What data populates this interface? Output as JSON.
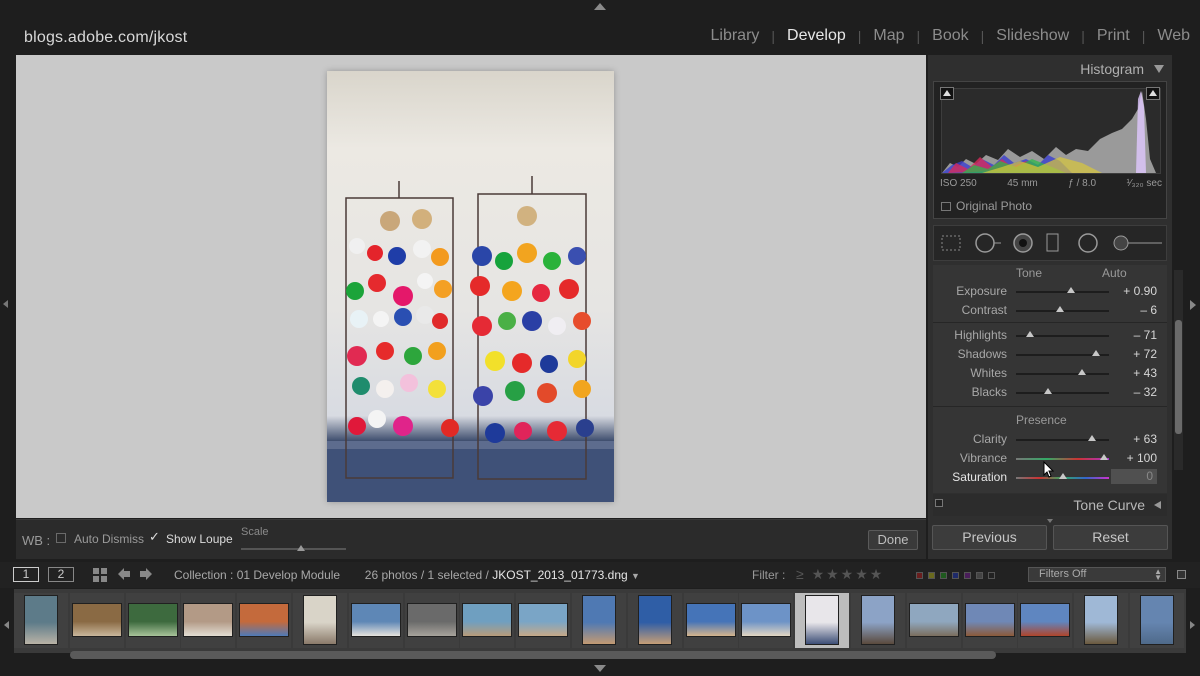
{
  "identity_plate": "blogs.adobe.com/jkost",
  "modules": [
    "Library",
    "Develop",
    "Map",
    "Book",
    "Slideshow",
    "Print",
    "Web"
  ],
  "active_module": "Develop",
  "toolbar": {
    "wb_label": "WB :",
    "auto_dismiss_label": "Auto Dismiss",
    "auto_dismiss_checked": false,
    "show_loupe_label": "Show Loupe",
    "show_loupe_checked": true,
    "scale_label": "Scale",
    "done_label": "Done"
  },
  "histogram": {
    "title": "Histogram",
    "iso": "ISO 250",
    "focal_length": "45 mm",
    "aperture": "ƒ / 8.0",
    "shutter": "¹⁄₃₂₀ sec",
    "original_photo_label": "Original Photo"
  },
  "tools": [
    "crop-overlay",
    "spot-removal",
    "red-eye",
    "graduated-filter",
    "radial-filter",
    "adjustment-brush"
  ],
  "basic": {
    "tone_label": "Tone",
    "auto_label": "Auto",
    "presence_label": "Presence",
    "sliders_tone": [
      {
        "label": "Exposure",
        "value": "+ 0.90",
        "pos": 0.59
      },
      {
        "label": "Contrast",
        "value": "– 6",
        "pos": 0.47
      }
    ],
    "sliders_tone2": [
      {
        "label": "Highlights",
        "value": "– 71",
        "pos": 0.15
      },
      {
        "label": "Shadows",
        "value": "+ 72",
        "pos": 0.86
      },
      {
        "label": "Whites",
        "value": "+ 43",
        "pos": 0.71
      },
      {
        "label": "Blacks",
        "value": "– 32",
        "pos": 0.34
      }
    ],
    "sliders_presence": [
      {
        "label": "Clarity",
        "value": "+ 63",
        "pos": 0.82
      },
      {
        "label": "Vibrance",
        "value": "+ 100",
        "pos": 0.95
      },
      {
        "label": "Saturation",
        "value": "0",
        "pos": 0.5
      }
    ]
  },
  "tone_curve_label": "Tone Curve",
  "buttons": {
    "previous": "Previous",
    "reset": "Reset"
  },
  "filmstrip_header": {
    "view1": "1",
    "view2": "2",
    "collection": "Collection : 01 Develop Module",
    "count": "26 photos / 1 selected /",
    "filename": "JKOST_2013_01773.dng",
    "filter_label": "Filter :",
    "filter_symbol": "≥",
    "filters_off": "Filters Off"
  },
  "colors": {
    "accent_text": "#e6e6e6",
    "panel_bg": "#2f2f2f",
    "canvas_bg": "#c9c9c9"
  },
  "filmstrip_thumbs": [
    {
      "c1": "#5d7b89",
      "c2": "#b9b3a6"
    },
    {
      "c1": "#8a6a44",
      "c2": "#c9b79c"
    },
    {
      "c1": "#3d6a3e",
      "c2": "#a8c39a"
    },
    {
      "c1": "#b39a86",
      "c2": "#e3ddd3"
    },
    {
      "c1": "#c46a3c",
      "c2": "#4f7ab8"
    },
    {
      "c1": "#d9d4c8",
      "c2": "#8a7a6a"
    },
    {
      "c1": "#5e87b6",
      "c2": "#e6e3dd"
    },
    {
      "c1": "#6a6a6a",
      "c2": "#a7a39c"
    },
    {
      "c1": "#6f9fc0",
      "c2": "#b89c7a"
    },
    {
      "c1": "#7aa5c6",
      "c2": "#c6a988"
    },
    {
      "c1": "#4f79b3",
      "c2": "#c39a72"
    },
    {
      "c1": "#2f5ea6",
      "c2": "#c79f76"
    },
    {
      "c1": "#4574b8",
      "c2": "#d4b48c"
    },
    {
      "c1": "#6d93c7",
      "c2": "#e2d6c2"
    },
    {
      "c1": "#e8e6ea",
      "c2": "#3d4e77"
    },
    {
      "c1": "#8ca3c6",
      "c2": "#5a4a3d"
    },
    {
      "c1": "#8fa7bf",
      "c2": "#7b6e5e"
    },
    {
      "c1": "#6f88b6",
      "c2": "#8c5a3a"
    },
    {
      "c1": "#5f86c0",
      "c2": "#b0452b"
    },
    {
      "c1": "#9fb8d6",
      "c2": "#6b5a3e"
    },
    {
      "c1": "#6585b0",
      "c2": "#4f6a8a"
    }
  ]
}
